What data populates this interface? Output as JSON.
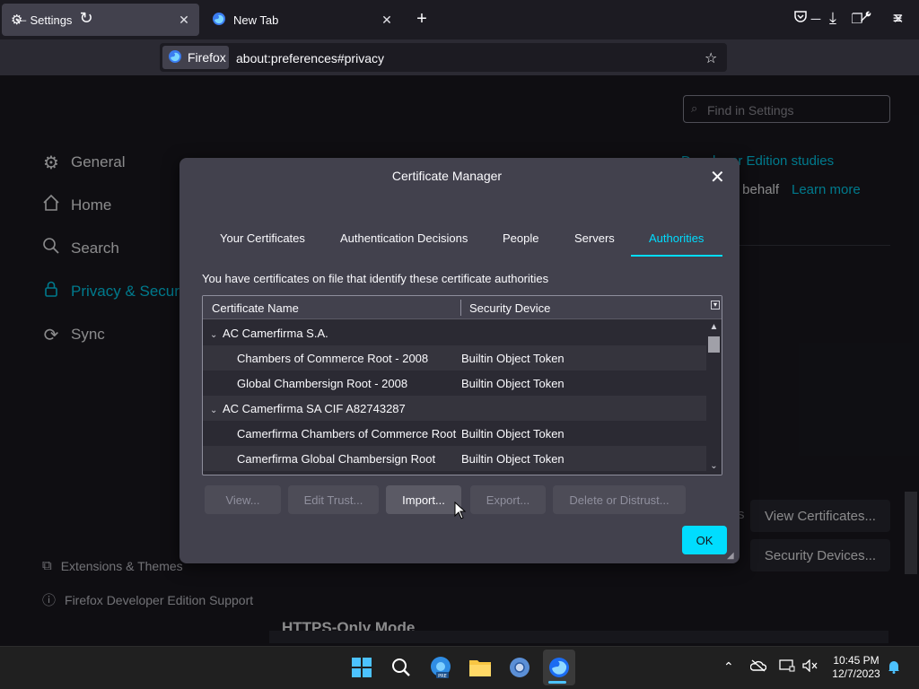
{
  "browser": {
    "tabs": [
      {
        "title": "Settings",
        "icon": "gear-icon"
      },
      {
        "title": "New Tab",
        "icon": "firefox-icon"
      }
    ],
    "identity_label": "Firefox",
    "url": "about:preferences#privacy",
    "window_controls": {
      "minimize": "─",
      "maximize": "❐",
      "close": "✕"
    }
  },
  "settings": {
    "search_placeholder": "Find in Settings",
    "nav": [
      {
        "label": "General",
        "icon": "gear-icon"
      },
      {
        "label": "Home",
        "icon": "home-icon"
      },
      {
        "label": "Search",
        "icon": "search-icon"
      },
      {
        "label": "Privacy & Security",
        "icon": "lock-icon"
      },
      {
        "label": "Sync",
        "icon": "sync-icon"
      }
    ],
    "footer": [
      {
        "label": "Extensions & Themes",
        "icon": "puzzle-icon"
      },
      {
        "label": "Firefox Developer Edition Support",
        "icon": "help-icon"
      }
    ],
    "bg_link_studies": "Developer Edition studies",
    "bg_behalf": "r behalf",
    "bg_learn_more": "Learn more",
    "bg_s": "s",
    "view_certificates": "View Certificates...",
    "security_devices": "Security Devices...",
    "https_only": "HTTPS-Only Mode"
  },
  "dialog": {
    "title": "Certificate Manager",
    "tabs": [
      "Your Certificates",
      "Authentication Decisions",
      "People",
      "Servers",
      "Authorities"
    ],
    "selected_tab": "Authorities",
    "description": "You have certificates on file that identify these certificate authorities",
    "columns": [
      "Certificate Name",
      "Security Device"
    ],
    "rows": [
      {
        "type": "group",
        "name": "AC Camerfirma S.A.",
        "device": ""
      },
      {
        "type": "child",
        "name": "Chambers of Commerce Root - 2008",
        "device": "Builtin Object Token"
      },
      {
        "type": "child",
        "name": "Global Chambersign Root - 2008",
        "device": "Builtin Object Token"
      },
      {
        "type": "group",
        "name": "AC Camerfirma SA CIF A82743287",
        "device": ""
      },
      {
        "type": "child",
        "name": "Camerfirma Chambers of Commerce Root",
        "device": "Builtin Object Token"
      },
      {
        "type": "child",
        "name": "Camerfirma Global Chambersign Root",
        "device": "Builtin Object Token"
      }
    ],
    "buttons": {
      "view": "View...",
      "edit_trust": "Edit Trust...",
      "import": "Import...",
      "export": "Export...",
      "delete": "Delete or Distrust...",
      "ok": "OK"
    }
  },
  "taskbar": {
    "time": "10:45 PM",
    "date": "12/7/2023",
    "icons": [
      "windows-start-icon",
      "search-icon",
      "edge-beta-icon",
      "file-explorer-icon",
      "chrome-canary-icon",
      "firefox-dev-icon"
    ]
  },
  "colors": {
    "accent": "#00ddff",
    "dialog_bg": "#42414d",
    "page_bg": "#1c1b22"
  }
}
